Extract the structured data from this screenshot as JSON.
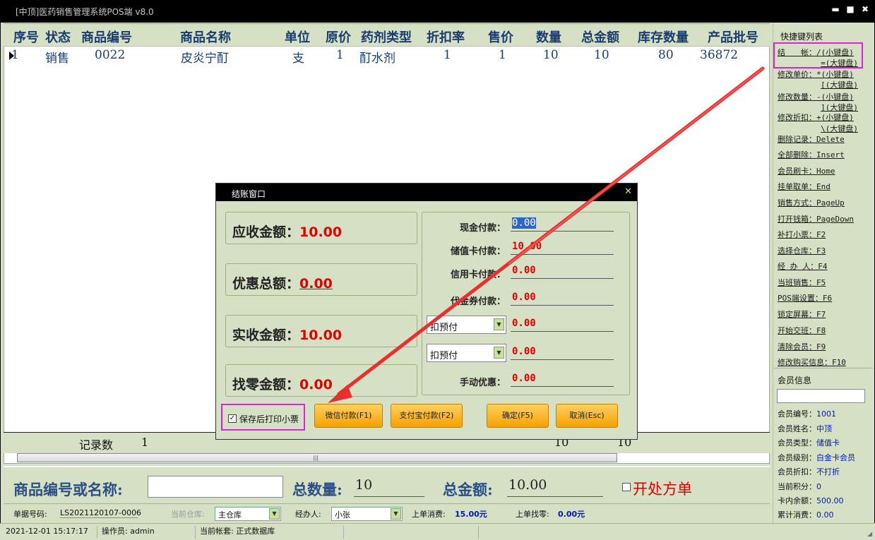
{
  "window": {
    "title": "[中顶]医药销售管理系统POS端 v8.0",
    "min": "▬",
    "max": "■",
    "close": "✖"
  },
  "grid": {
    "columns": [
      "序号",
      "状态",
      "商品编号",
      "商品名称",
      "单位",
      "原价",
      "药剂类型",
      "折扣率",
      "售价",
      "数量",
      "总金额",
      "库存数量",
      "产品批号"
    ],
    "row": [
      "1",
      "销售",
      "0022",
      "皮炎宁酊",
      "支",
      "1",
      "酊水剂",
      "1",
      "1",
      "10",
      "10",
      "80",
      "36872"
    ],
    "footer": {
      "label": "记录数",
      "count": "1",
      "qty": "10",
      "total": "10"
    }
  },
  "shortcuts": {
    "title": "快捷键列表",
    "items": [
      {
        "a": "结　　帐：/(小键盘)",
        "b": "=(大键盘)"
      },
      {
        "a": "修改单价：*(小键盘)",
        "b": "[(大键盘)"
      },
      {
        "a": "修改数量：-(小键盘)",
        "b": "](大键盘)"
      },
      {
        "a": "修改折扣：+(小键盘)",
        "b": "\\(大键盘)"
      },
      {
        "a": "删除记录：Delete"
      },
      {
        "a": "全部删除：Insert"
      },
      {
        "a": "会员刷卡：Home"
      },
      {
        "a": "挂单取单：End"
      },
      {
        "a": "销售方式：PageUp"
      },
      {
        "a": "打开钱箱：PageDown"
      },
      {
        "a": "补打小票：F2"
      },
      {
        "a": "选择仓库：F3"
      },
      {
        "a": "经 办 人：F4"
      },
      {
        "a": "当班销售：F5"
      },
      {
        "a": "POS端设置：F6"
      },
      {
        "a": "锁定屏幕：F7"
      },
      {
        "a": "开始交班：F8"
      },
      {
        "a": "清除会员：F9"
      },
      {
        "a": "修改购买信息：F10"
      }
    ]
  },
  "member": {
    "title": "会员信息",
    "fields": [
      {
        "k": "会员编号：",
        "v": "1001"
      },
      {
        "k": "会员姓名：",
        "v": "中顶"
      },
      {
        "k": "会员类型：",
        "v": "储值卡"
      },
      {
        "k": "会员级别：",
        "v": "白金卡会员"
      },
      {
        "k": "会员折扣：",
        "v": "不打折"
      },
      {
        "k": "当前积分：",
        "v": "0"
      },
      {
        "k": "卡内余额：",
        "v": "500.00"
      },
      {
        "k": "累计消费：",
        "v": "0.00"
      }
    ]
  },
  "bottom": {
    "search_label": "商品编号或名称:",
    "total_qty_label": "总数量:",
    "total_qty": "10",
    "total_amount_label": "总金额:",
    "total_amount": "10.00",
    "prescription": "开处方单"
  },
  "info": {
    "bill_no_label": "单据号码:",
    "bill_no": "LS2021120107-0006",
    "warehouse_label": "当前仓库:",
    "warehouse": "主仓库",
    "handler_label": "经办人:",
    "handler": "小张",
    "last_spend_label": "上单消费:",
    "last_spend": "15.00元",
    "last_change_label": "上单找零:",
    "last_change": "0.00元"
  },
  "status": {
    "datetime": "2021-12-01 15:17:17",
    "operator": "操作员: admin",
    "account": "当前帐套: 正式数据库"
  },
  "dialog": {
    "title": "结账窗口",
    "receivable_label": "应收金额：",
    "receivable": "10.00",
    "discount_label": "优惠总额：",
    "discount": "0.00",
    "actual_label": "实收金额：",
    "actual": "10.00",
    "change_label": "找零金额：",
    "change": "0.00",
    "cash_label": "现金付款：",
    "cash": "0.00",
    "stored_label": "储值卡付款：",
    "stored": "10.00",
    "credit_label": "信用卡付款：",
    "credit": "0.00",
    "voucher_label": "代金券付款：",
    "voucher": "0.00",
    "prepay1": "扣预付",
    "prepay1_value": "0.00",
    "prepay2": "扣预付",
    "prepay2_value": "0.00",
    "manual_label": "手动优惠：",
    "manual": "0.00",
    "print_label": "保存后打印小票",
    "wechat_btn": "微信付款(F1)",
    "alipay_btn": "支付宝付款(F2)",
    "ok_btn": "确定(F5)",
    "cancel_btn": "取消(Esc)"
  }
}
